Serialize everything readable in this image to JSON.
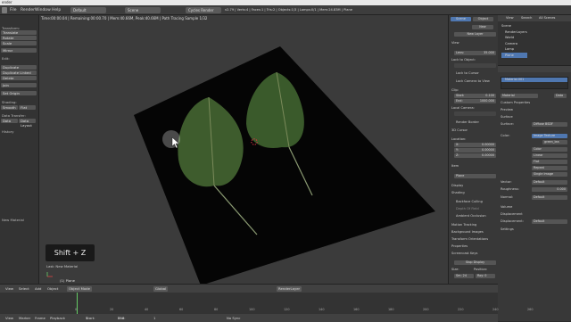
{
  "window": {
    "title": "ender"
  },
  "menubar": {
    "items": [
      "File",
      "Render",
      "Window",
      "Help"
    ],
    "layout": "Default",
    "scene": "Scene",
    "engine": "Cycles Render",
    "stats": "v2.79 | Verts:4 | Faces:1 | Tris:2 | Objects:1/3 | Lamps:0/1 | Mem:24.83M | Plane"
  },
  "viewport": {
    "render_status": "Time:00:00.04 | Remaining:00:00.70 | Mem:40.66M, Peak:40.66M | Path Tracing Sample 1/32",
    "object_label": "(1) Plane",
    "last_op": "Last: New Material",
    "shortcut_overlay": "Shift + Z"
  },
  "toolshelf": {
    "sections": {
      "transform": "Transform:",
      "edit": "Edit:",
      "shading": "Shading:",
      "data_transfer": "Data Transfer:",
      "history": "History"
    },
    "buttons": [
      "Translate",
      "Rotate",
      "Scale",
      "Mirror"
    ],
    "edit_buttons": [
      "Duplicate",
      "Duplicate Linked",
      "Delete",
      "Join"
    ],
    "set_origin": "Set Origin",
    "smooth": "Smooth",
    "flat": "Flat",
    "data": "Data",
    "data_layout": "Data Layout",
    "new_material": "New Material"
  },
  "npanel": {
    "tabs": [
      "Scene",
      "Object"
    ],
    "new_label": "New",
    "new_layer": "New Layer",
    "view_header": "View",
    "lens_label": "Lens:",
    "lens_value": "35.000",
    "lock_to_object": "Lock to Object:",
    "lock_to_cursor": "Lock to Cursor",
    "lock_camera": "Lock Camera to View",
    "clip_header": "Clip:",
    "start_label": "Start:",
    "start_value": "0.100",
    "end_label": "End:",
    "end_value": "1000.000",
    "local_camera": "Local Camera:",
    "render_border": "Render Border",
    "cursor_header": "3D Cursor",
    "location": "Location:",
    "x_label": "X:",
    "x_value": "0.00000",
    "y_label": "Y:",
    "y_value": "0.00000",
    "z_label": "Z:",
    "z_value": "0.00000",
    "item_header": "Item",
    "item_name": "Plane",
    "display_header": "Display",
    "shading_header": "Shading",
    "backface": "Backface Culling",
    "depth_of_field": "Depth Of Field",
    "ambient": "Ambient Occlusion",
    "motion_tracking": "Motion Tracking",
    "background_images": "Background Images",
    "transform_orient": "Transform Orientations",
    "properties": "Properties",
    "screencast": "Screencast Keys",
    "stop_display": "Stop Display",
    "size_label": "Size:",
    "position_label": "Position:",
    "size_value": "Sm: 24",
    "position_value": "Roy: 0"
  },
  "outliner": {
    "menu": [
      "View",
      "Search",
      "All Scenes"
    ],
    "items": [
      "Scene",
      "RenderLayers",
      "World",
      "Camera",
      "Lamp",
      "Plane"
    ]
  },
  "properties": {
    "material_slot": "Material.001",
    "material_field": "Material",
    "data_tab": "Data",
    "sections": [
      "Preview",
      "Surface",
      "Volume",
      "Displacement",
      "Settings"
    ],
    "custom_props": "Custom Properties",
    "surface_label": "Surface:",
    "surface_value": "Diffuse BSDF",
    "color_label": "Color:",
    "color_value": "Image Texture",
    "image_name": "green_lea",
    "interp_values": [
      "Color",
      "Linear",
      "Flat",
      "Repeat",
      "Single Image"
    ],
    "vector_label": "Vector:",
    "vector_value": "Default",
    "roughness_label": "Roughness:",
    "roughness_value": "0.000",
    "normal_label": "Normal:",
    "normal_value": "Default",
    "displacement_label": "Displacement:",
    "displacement_value": "Default"
  },
  "vp_toolbar": {
    "items": [
      "View",
      "Select",
      "Add",
      "Object"
    ],
    "mode": "Object Mode",
    "orientation": "Global",
    "render_layer": "RenderLayer"
  },
  "timeline": {
    "menu": [
      "View",
      "Marker",
      "Frame",
      "Playback"
    ],
    "start_label": "Start:",
    "start_value": "1",
    "end_label": "End:",
    "end_value": "250",
    "current": "1",
    "sync": "No Sync",
    "ticks": [
      "0",
      "20",
      "40",
      "60",
      "80",
      "100",
      "120",
      "140",
      "160",
      "180",
      "200",
      "220",
      "240",
      "260"
    ]
  },
  "colors": {
    "accent": "#4f77b0",
    "viewport_bg": "#3b3b3b",
    "plane": "#050505",
    "leaf": "#3c5a2b"
  }
}
